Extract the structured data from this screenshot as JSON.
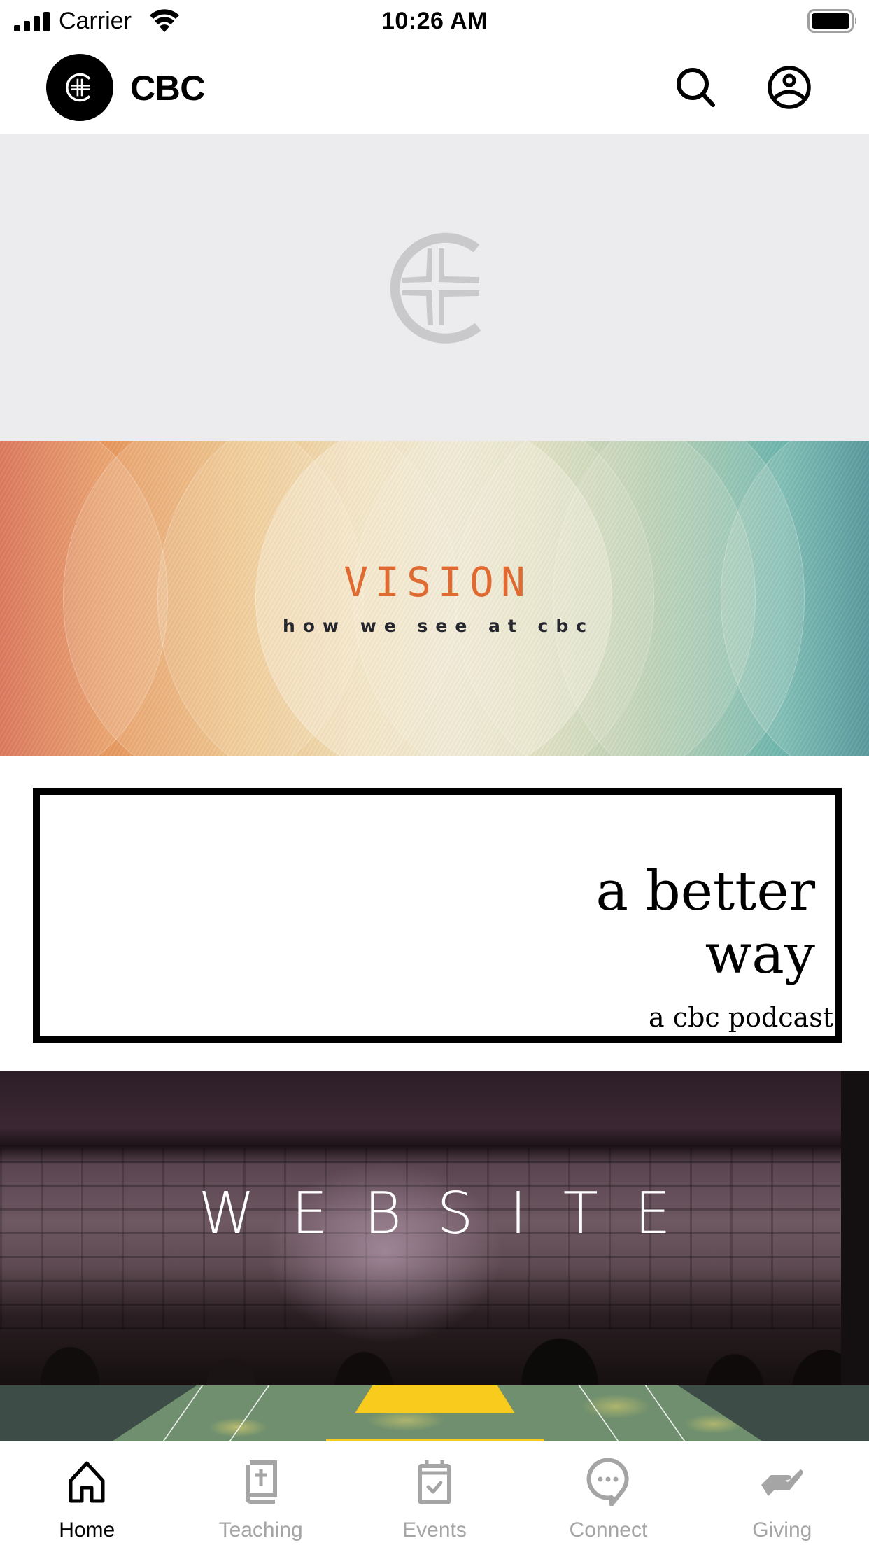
{
  "status_bar": {
    "carrier": "Carrier",
    "time": "10:26 AM",
    "signal_icon": "cellular-signal-icon",
    "wifi_icon": "wifi-icon",
    "battery_icon": "battery-icon"
  },
  "header": {
    "logo_icon": "cbc-cross-logo",
    "title": "CBC",
    "search_icon": "search-icon",
    "profile_icon": "user-circle-icon"
  },
  "feed": {
    "placeholder_icon": "cbc-cross-logo",
    "cards": [
      {
        "id": "vision",
        "title": "VISION",
        "subtitle": "how we see at cbc",
        "colors": {
          "title": "#df6a32",
          "subtitle": "#26262e"
        }
      },
      {
        "id": "podcast",
        "line1": "a better",
        "line2": "way",
        "line3": "a cbc podcast"
      },
      {
        "id": "website",
        "title": "WEBSITE"
      },
      {
        "id": "partial-banner",
        "colors": {
          "accent": "#f8cb1c",
          "field": "#6f8f6e"
        }
      }
    ]
  },
  "tab_bar": {
    "active_color": "#000000",
    "inactive_color": "#a5a5a5",
    "tabs": [
      {
        "label": "Home",
        "icon": "home-icon",
        "active": true
      },
      {
        "label": "Teaching",
        "icon": "bible-icon",
        "active": false
      },
      {
        "label": "Events",
        "icon": "calendar-check-icon",
        "active": false
      },
      {
        "label": "Connect",
        "icon": "chat-bubble-icon",
        "active": false
      },
      {
        "label": "Giving",
        "icon": "giving-hand-icon",
        "active": false
      }
    ]
  }
}
